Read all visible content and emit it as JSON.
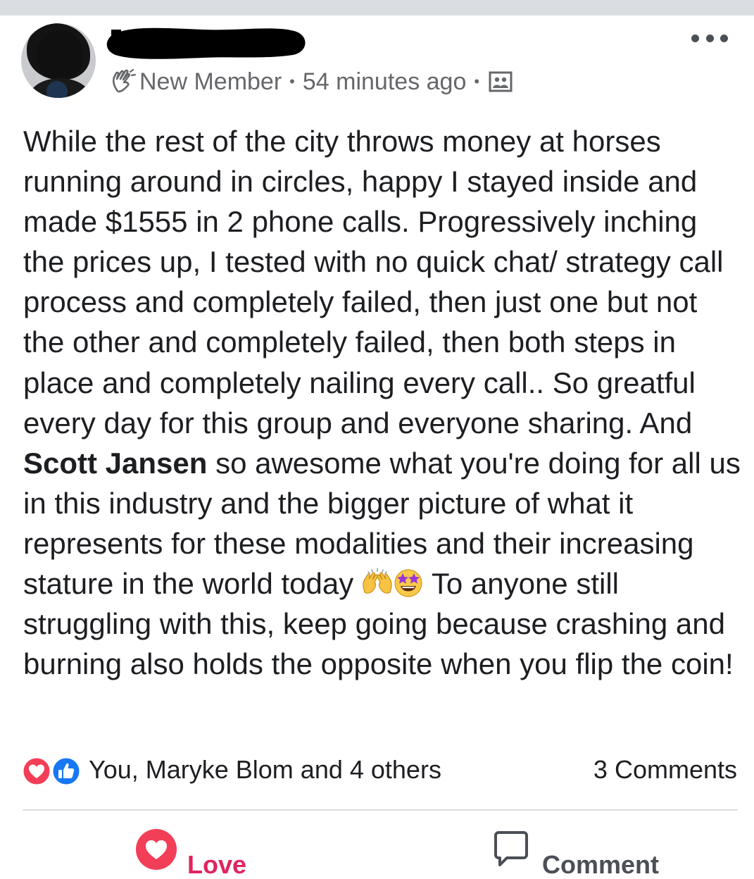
{
  "header": {
    "author_name_redacted": "",
    "badge_label": "New Member",
    "time_ago": "54 minutes ago",
    "separator": "•"
  },
  "post": {
    "text_before_mention": "While the rest of the city throws money at horses running around in circles, happy I stayed inside and made $1555 in 2 phone calls. Progressively inching the prices up, I tested with no quick chat/ strategy call process and completely failed, then just one but not the other and completely failed, then both steps in place and completely nailing every call.. So greatful every day for this group and everyone sharing. And ",
    "mention": "Scott Jansen",
    "text_after_mention": " so awesome what you're doing for all us in this industry and the bigger picture of what it represents for these modalities and their increasing stature in the world today ",
    "text_after_emoji": " To anyone still struggling with this, keep going because crashing and burning also holds the opposite when you flip the coin!",
    "emojis": [
      "raising-hands",
      "star-struck"
    ]
  },
  "reactions": {
    "summary": "You, Maryke Blom and 4 others",
    "types": [
      "love",
      "like"
    ]
  },
  "comments_count": "3 Comments",
  "actions": {
    "love_label": "Love",
    "comment_label": "Comment"
  },
  "colors": {
    "love": "#f33e58",
    "like": "#1877f2",
    "secondary_text": "#65676b",
    "primary_text": "#1c1e21",
    "divider": "#dadde1"
  }
}
